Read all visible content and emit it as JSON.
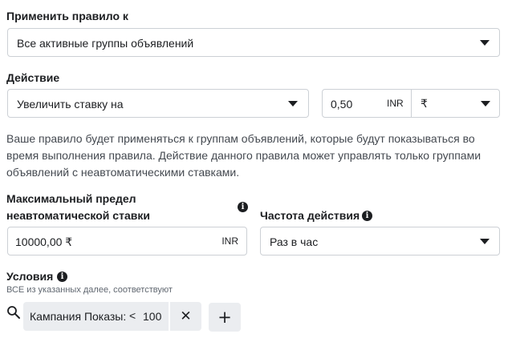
{
  "apply_rule": {
    "label": "Применить правило к",
    "selected": "Все активные группы объявлений"
  },
  "action": {
    "label": "Действие",
    "selected": "Увеличить ставку на",
    "amount": "0,50",
    "amount_unit": "INR",
    "currency": "₹"
  },
  "help_text": "Ваше правило будет применяться к группам объявлений, которые будут показываться во время выполнения правила. Действие данного правила может управлять только группами объявлений с неавтоматическими ставками.",
  "max_bid": {
    "label_line1": "Максимальный предел",
    "label_line2": "неавтоматической ставки",
    "value": "10000,00 ₹",
    "unit": "INR"
  },
  "frequency": {
    "label": "Частота действия",
    "selected": "Раз в час"
  },
  "conditions": {
    "label": "Условия",
    "subtitle": "ВСЕ из указанных далее, соответствуют",
    "items": [
      {
        "field": "Кампания Показы:",
        "operator": "<",
        "value": "100"
      }
    ],
    "remove_symbol": "✕",
    "add_symbol": "+"
  },
  "info_glyph": "i",
  "icons": [
    "info-icon",
    "search-icon",
    "close-icon",
    "plus-icon",
    "chevron-down-icon"
  ]
}
